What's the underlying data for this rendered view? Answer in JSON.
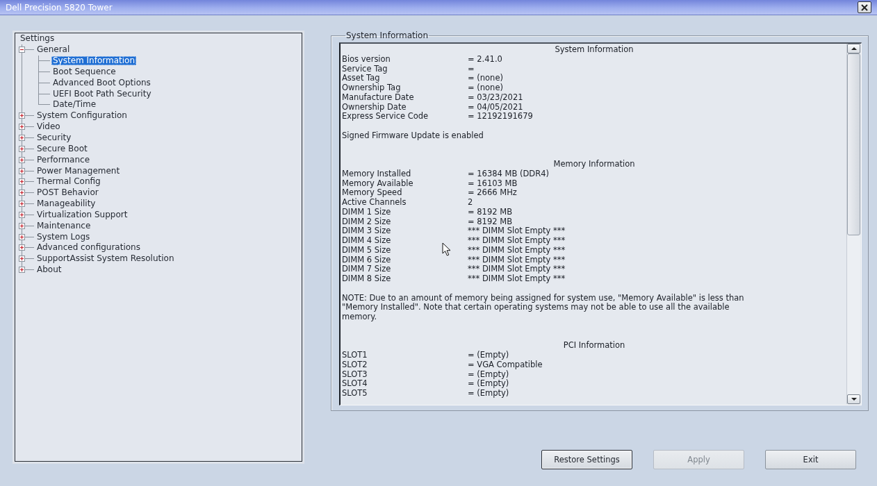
{
  "window": {
    "title": "Dell Precision 5820 Tower"
  },
  "settings_tree": {
    "root": "Settings",
    "items": [
      {
        "label": "General",
        "expanded": true,
        "selected": false,
        "children": [
          {
            "label": "System Information",
            "selected": true
          },
          {
            "label": "Boot Sequence",
            "selected": false
          },
          {
            "label": "Advanced Boot Options",
            "selected": false
          },
          {
            "label": "UEFI Boot Path Security",
            "selected": false
          },
          {
            "label": "Date/Time",
            "selected": false
          }
        ]
      },
      {
        "label": "System Configuration",
        "expanded": false,
        "selected": false
      },
      {
        "label": "Video",
        "expanded": false,
        "selected": false
      },
      {
        "label": "Security",
        "expanded": false,
        "selected": false
      },
      {
        "label": "Secure Boot",
        "expanded": false,
        "selected": false
      },
      {
        "label": "Performance",
        "expanded": false,
        "selected": false
      },
      {
        "label": "Power Management",
        "expanded": false,
        "selected": false
      },
      {
        "label": "Thermal Config",
        "expanded": false,
        "selected": false
      },
      {
        "label": "POST Behavior",
        "expanded": false,
        "selected": false
      },
      {
        "label": "Manageability",
        "expanded": false,
        "selected": false
      },
      {
        "label": "Virtualization Support",
        "expanded": false,
        "selected": false
      },
      {
        "label": "Maintenance",
        "expanded": false,
        "selected": false
      },
      {
        "label": "System Logs",
        "expanded": false,
        "selected": false
      },
      {
        "label": "Advanced configurations",
        "expanded": false,
        "selected": false
      },
      {
        "label": "SupportAssist System Resolution",
        "expanded": false,
        "selected": false
      },
      {
        "label": "About",
        "expanded": false,
        "selected": false
      }
    ]
  },
  "info_panel": {
    "title": "System Information",
    "sections": [
      {
        "heading": "System Information",
        "rows": [
          {
            "label": "Bios version",
            "value": "= 2.41.0"
          },
          {
            "label": "Service Tag",
            "value": "="
          },
          {
            "label": "Asset Tag",
            "value": "= (none)"
          },
          {
            "label": "Ownership Tag",
            "value": "= (none)"
          },
          {
            "label": "Manufacture Date",
            "value": "= 03/23/2021"
          },
          {
            "label": "Ownership Date",
            "value": "= 04/05/2021"
          },
          {
            "label": "Express Service Code",
            "value": "= 12192191679"
          }
        ],
        "note": "Signed Firmware Update is enabled"
      },
      {
        "heading": "Memory Information",
        "rows": [
          {
            "label": "Memory Installed",
            "value": "= 16384 MB (DDR4)"
          },
          {
            "label": "Memory Available",
            "value": "= 16103 MB"
          },
          {
            "label": "Memory Speed",
            "value": "= 2666 MHz"
          },
          {
            "label": "Active Channels",
            "value": "2"
          },
          {
            "label": "DIMM 1 Size",
            "value": "= 8192 MB"
          },
          {
            "label": "DIMM 2 Size",
            "value": "= 8192 MB"
          },
          {
            "label": "DIMM 3 Size",
            "value": "*** DIMM Slot Empty ***"
          },
          {
            "label": "DIMM 4 Size",
            "value": "*** DIMM Slot Empty ***"
          },
          {
            "label": "DIMM 5 Size",
            "value": "*** DIMM Slot Empty ***"
          },
          {
            "label": "DIMM 6 Size",
            "value": "*** DIMM Slot Empty ***"
          },
          {
            "label": "DIMM 7 Size",
            "value": "*** DIMM Slot Empty ***"
          },
          {
            "label": "DIMM 8 Size",
            "value": "*** DIMM Slot Empty ***"
          }
        ],
        "note": "NOTE: Due to an amount of memory being assigned for system use, \"Memory Available\" is less than \"Memory Installed\". Note that certain operating systems may not be able to use all the available memory."
      },
      {
        "heading": "PCI Information",
        "rows": [
          {
            "label": "SLOT1",
            "value": "= (Empty)"
          },
          {
            "label": "SLOT2",
            "value": "= VGA Compatible"
          },
          {
            "label": "SLOT3",
            "value": "= (Empty)"
          },
          {
            "label": "SLOT4",
            "value": "= (Empty)"
          },
          {
            "label": "SLOT5",
            "value": "= (Empty)"
          }
        ]
      }
    ]
  },
  "buttons": [
    {
      "label": "Restore Settings",
      "disabled": false,
      "focused": true
    },
    {
      "label": "Apply",
      "disabled": true,
      "focused": false
    },
    {
      "label": "Exit",
      "disabled": false,
      "focused": false
    }
  ]
}
